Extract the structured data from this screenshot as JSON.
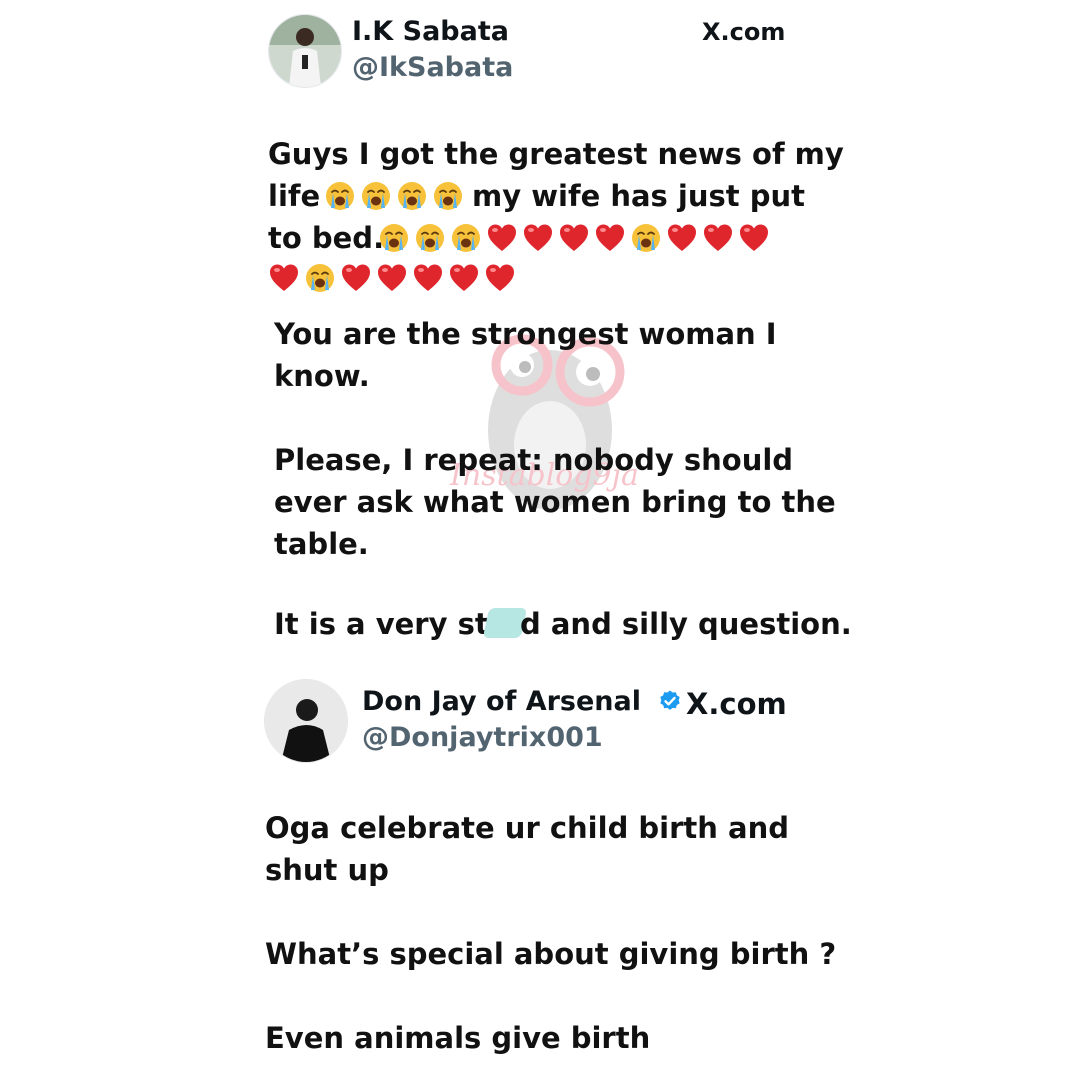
{
  "tweet1": {
    "name": "I.K Sabata",
    "handle": "@IkSabata",
    "site": "X.com",
    "line1": "Guys I got the greatest news of my",
    "line2_a": "life",
    "line2_b": "my wife has just put",
    "line3_a": "to bed.",
    "emoji_line2": [
      "crying",
      "crying",
      "crying",
      "crying"
    ],
    "emoji_line3": [
      "crying",
      "crying",
      "crying",
      "heart",
      "heart",
      "heart",
      "heart",
      "crying",
      "heart",
      "heart",
      "heart"
    ],
    "emoji_line4": [
      "heart",
      "crying",
      "heart",
      "heart",
      "heart",
      "heart",
      "heart"
    ],
    "para1": "You are the strongest woman I\nknow.",
    "para2": "Please, I repeat: nobody should\never ask what women bring to the\ntable.",
    "para3_a": "It is a very stu",
    "para3_b": "d and silly question."
  },
  "tweet2": {
    "name": "Don Jay of Arsenal",
    "handle": "@Donjaytrix001",
    "site": "X.com",
    "verified_icon": "verified-badge-icon",
    "para1": "Oga celebrate ur child birth and\nshut up",
    "para2": "What’s special about giving birth ?",
    "para3": "Even animals give birth"
  },
  "colors": {
    "heart": "#e0262d",
    "crying_face": "#f7c23a",
    "verified": "#1d9bf0",
    "handle_gray": "#536471"
  },
  "watermark": {
    "text": "Instablog9ja"
  }
}
